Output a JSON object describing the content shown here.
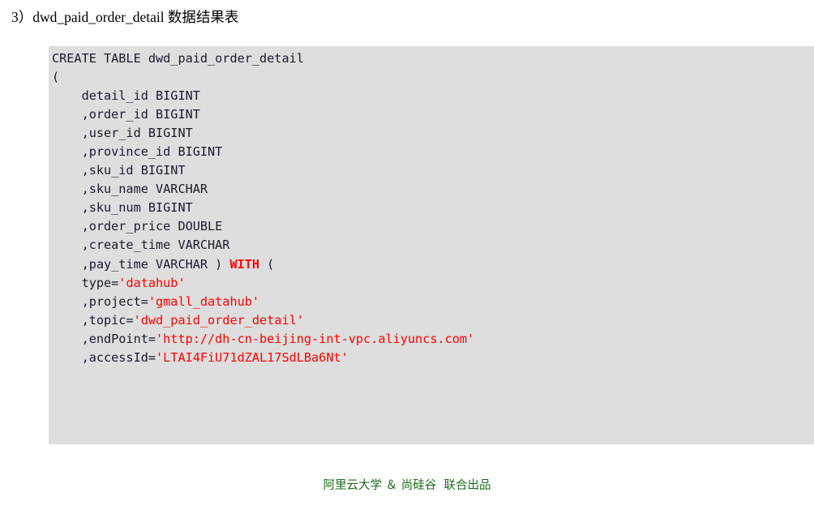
{
  "heading": {
    "text": "3）dwd_paid_order_detail 数据结果表"
  },
  "code_block": {
    "background_color": "#dedede",
    "string_color": "#ff0000",
    "keyword_color": "#ff0000",
    "text_color": "#1a1a2e",
    "lines": [
      {
        "id": "line-1",
        "tokens": [
          {
            "t": "CREATE TABLE dwd_paid_order_detail",
            "c": "plain"
          }
        ]
      },
      {
        "id": "line-2",
        "tokens": [
          {
            "t": "(",
            "c": "plain"
          }
        ]
      },
      {
        "id": "line-3",
        "tokens": [
          {
            "t": "    detail_id BIGINT",
            "c": "plain"
          }
        ]
      },
      {
        "id": "line-4",
        "tokens": [
          {
            "t": "    ,order_id BIGINT",
            "c": "plain"
          }
        ]
      },
      {
        "id": "line-5",
        "tokens": [
          {
            "t": "    ,user_id BIGINT",
            "c": "plain"
          }
        ]
      },
      {
        "id": "line-6",
        "tokens": [
          {
            "t": "    ,province_id BIGINT",
            "c": "plain"
          }
        ]
      },
      {
        "id": "line-7",
        "tokens": [
          {
            "t": "    ,sku_id BIGINT",
            "c": "plain"
          }
        ]
      },
      {
        "id": "line-8",
        "tokens": [
          {
            "t": "    ,sku_name VARCHAR",
            "c": "plain"
          }
        ]
      },
      {
        "id": "line-9",
        "tokens": [
          {
            "t": "    ,sku_num BIGINT",
            "c": "plain"
          }
        ]
      },
      {
        "id": "line-10",
        "tokens": [
          {
            "t": "    ,order_price DOUBLE",
            "c": "plain"
          }
        ]
      },
      {
        "id": "line-11",
        "tokens": [
          {
            "t": "    ,create_time VARCHAR",
            "c": "plain"
          }
        ]
      },
      {
        "id": "line-12",
        "tokens": [
          {
            "t": "    ,pay_time VARCHAR ) ",
            "c": "plain"
          },
          {
            "t": "WITH",
            "c": "kw"
          },
          {
            "t": " (",
            "c": "plain"
          }
        ]
      },
      {
        "id": "line-13",
        "tokens": [
          {
            "t": "    type=",
            "c": "plain"
          },
          {
            "t": "'datahub'",
            "c": "str"
          }
        ]
      },
      {
        "id": "line-14",
        "tokens": [
          {
            "t": "    ,project=",
            "c": "plain"
          },
          {
            "t": "'gmall_datahub'",
            "c": "str"
          }
        ]
      },
      {
        "id": "line-15",
        "tokens": [
          {
            "t": "    ,topic=",
            "c": "plain"
          },
          {
            "t": "'dwd_paid_order_detail'",
            "c": "str"
          }
        ]
      },
      {
        "id": "line-16",
        "tokens": [
          {
            "t": "    ,endPoint=",
            "c": "plain"
          },
          {
            "t": "'http://dh-cn-beijing-int-vpc.aliyuncs.com'",
            "c": "str"
          }
        ]
      },
      {
        "id": "line-17",
        "tokens": [
          {
            "t": "    ,accessId=",
            "c": "plain"
          },
          {
            "t": "'LTAI4FiU71dZAL17SdLBa6Nt'",
            "c": "str"
          }
        ]
      }
    ]
  },
  "footer": {
    "credit": "阿里云大学 ＆ 尚硅谷  联合出品",
    "color": "#1a6b1a"
  }
}
